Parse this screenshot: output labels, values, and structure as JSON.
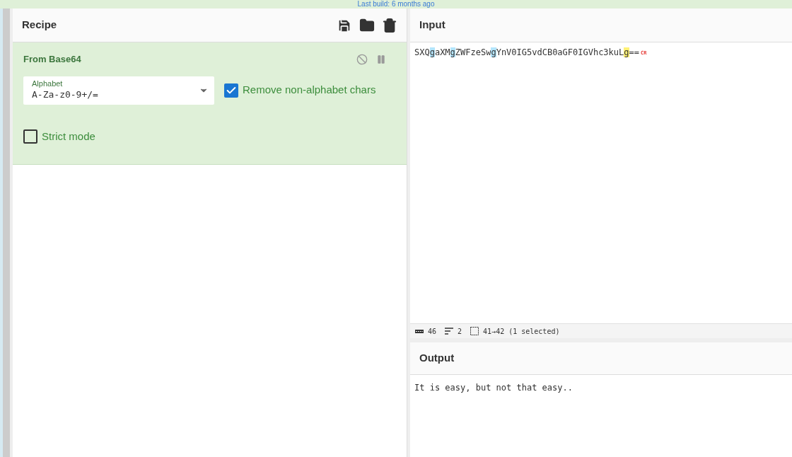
{
  "banner": {
    "text": "Last build: 6 months ago"
  },
  "recipe": {
    "title": "Recipe",
    "operations": [
      {
        "name": "From Base64",
        "disabled": false,
        "paused": false,
        "alphabet": {
          "label": "Alphabet",
          "value": "A-Za-z0-9+/="
        },
        "options": [
          {
            "kind": "checkbox",
            "label": "Remove non-alphabet chars",
            "checked": true
          },
          {
            "kind": "checkbox",
            "label": "Strict mode",
            "checked": false
          }
        ]
      }
    ]
  },
  "input": {
    "title": "Input",
    "segments": [
      {
        "text": "SXQ",
        "highlighted": false,
        "selected": false
      },
      {
        "text": "g",
        "highlighted": true,
        "selected": false
      },
      {
        "text": "aXM",
        "highlighted": false,
        "selected": false
      },
      {
        "text": "g",
        "highlighted": true,
        "selected": false
      },
      {
        "text": "ZWFzeSw",
        "highlighted": false,
        "selected": false
      },
      {
        "text": "g",
        "highlighted": true,
        "selected": false
      },
      {
        "text": "YnV0IG5vdCB0aGF0IGVhc3kuL",
        "highlighted": false,
        "selected": false
      },
      {
        "text": "g",
        "highlighted": false,
        "selected": true
      },
      {
        "text": "==",
        "highlighted": false,
        "selected": false
      }
    ],
    "line_end": "CR",
    "status": {
      "length": "46",
      "lines": "2",
      "selection": "41→42 (1 selected)"
    }
  },
  "output": {
    "title": "Output",
    "text": "It is easy, but not that easy.."
  }
}
